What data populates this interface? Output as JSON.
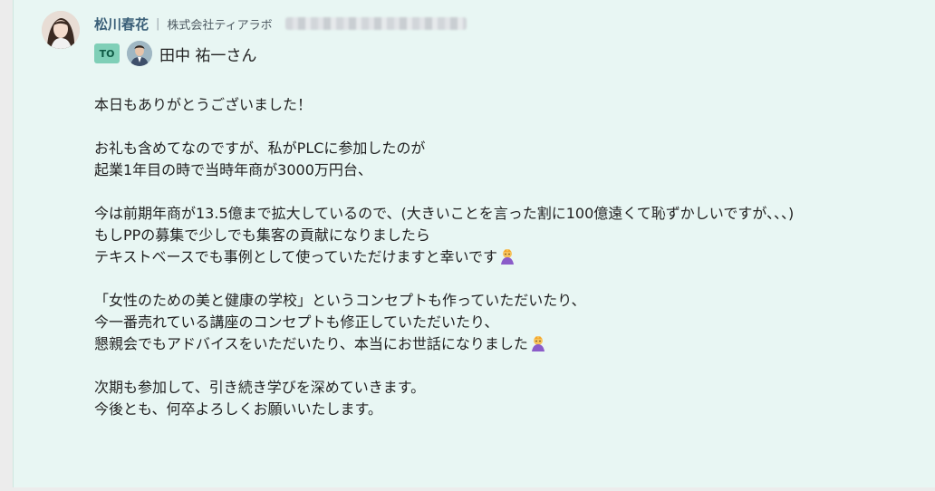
{
  "sender": {
    "name": "松川春花",
    "separator": "|",
    "company": "株式会社ティアラボ"
  },
  "recipient": {
    "badge": "TO",
    "name": "田中 祐一さん"
  },
  "message": {
    "lines": [
      "本日もありがとうございました！",
      "",
      "お礼も含めてなのですが、私がPLCに参加したのが",
      "起業1年目の時で当時年商が3000万円台、",
      "",
      "今は前期年商が13.5億まで拡大しているので、(大きいことを言った割に100億遠くて恥ずかしいですが、、、)",
      "もしPPの募集で少しでも集客の貢献になりましたら",
      "テキストベースでも事例として使っていただけますと幸いです",
      "",
      "「女性のための美と健康の学校」というコンセプトも作っていただいたり、",
      "今一番売れている講座のコンセプトも修正していただいたり、",
      "懇親会でもアドバイスをいただいたり、本当にお世話になりました",
      "",
      "次期も参加して、引き続き学びを深めていきます。",
      "今後とも、何卒よろしくお願いいたします。"
    ]
  },
  "icons": {
    "sender_avatar": "woman-avatar-icon",
    "recipient_avatar": "man-avatar-icon",
    "bow_emoji": "bowing-person-emoji-icon"
  },
  "colors": {
    "message_background": "#e8f6f3",
    "to_badge": "#7fcfb7",
    "sender_name": "#3a5f78"
  }
}
